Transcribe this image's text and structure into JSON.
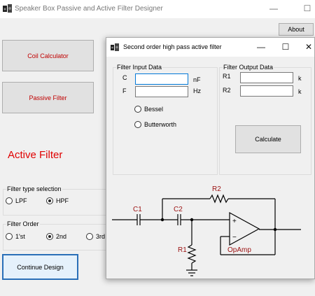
{
  "main_window": {
    "title": "Speaker Box Passive and Active Filter Designer",
    "controls": {
      "minimize": "—",
      "maximize": "☐"
    },
    "about_label": "About",
    "coil_calculator_label": "Coil Calculator",
    "passive_filter_label": "Passive Filter",
    "active_filter_heading": "Active Filter",
    "filter_type": {
      "label": "Filter type selection",
      "options": [
        {
          "label": "LPF",
          "checked": false
        },
        {
          "label": "HPF",
          "checked": true
        }
      ]
    },
    "filter_order": {
      "label": "Filter Order",
      "options": [
        {
          "label": "1'st",
          "checked": false
        },
        {
          "label": "2nd",
          "checked": true
        },
        {
          "label": "3rd",
          "checked": false
        }
      ]
    },
    "continue_label": "Continue Design"
  },
  "dialog": {
    "title": "Second order high pass active filter",
    "controls": {
      "minimize": "—",
      "maximize": "☐",
      "close": "✕"
    },
    "input_group": {
      "label": "Filter Input Data",
      "fields": [
        {
          "label": "C",
          "value": "",
          "unit": "nF"
        },
        {
          "label": "F",
          "value": "",
          "unit": "Hz"
        }
      ],
      "options": [
        {
          "label": "Bessel",
          "checked": false
        },
        {
          "label": "Butterworth",
          "checked": false
        }
      ]
    },
    "output_group": {
      "label": "Filter Output Data",
      "fields": [
        {
          "label": "R1",
          "value": "",
          "unit": "k"
        },
        {
          "label": "R2",
          "value": "",
          "unit": "k"
        }
      ]
    },
    "calculate_label": "Calculate",
    "schematic": {
      "c1": "C1",
      "c2": "C2",
      "r1": "R1",
      "r2": "R2",
      "plus": "+",
      "minus": "−",
      "opamp": "OpAmp",
      "label_color": "#9a1010"
    }
  },
  "colors": {
    "accent_red": "#e00000",
    "button_red_text": "#c00000",
    "focus_blue": "#2a6fb8"
  }
}
